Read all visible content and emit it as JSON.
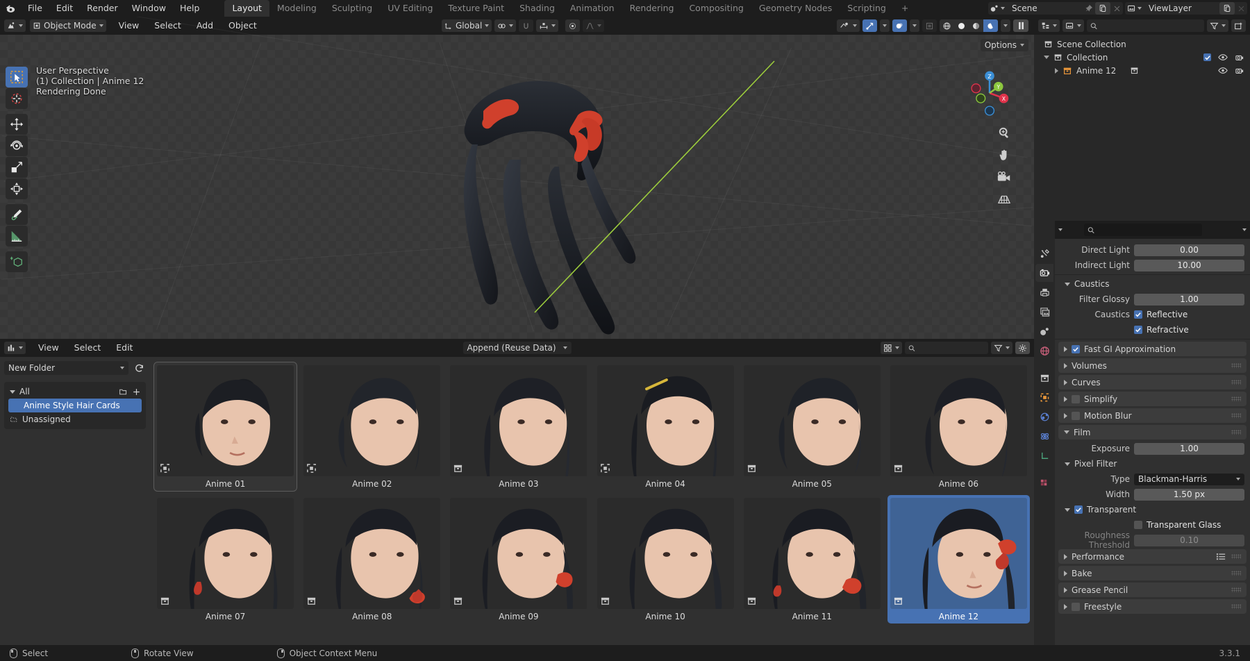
{
  "app": {
    "name": "Blender",
    "version": "3.3.1"
  },
  "topbar": {
    "menus": [
      "File",
      "Edit",
      "Render",
      "Window",
      "Help"
    ],
    "workspaces": [
      {
        "label": "Layout",
        "active": true
      },
      {
        "label": "Modeling",
        "active": false
      },
      {
        "label": "Sculpting",
        "active": false
      },
      {
        "label": "UV Editing",
        "active": false
      },
      {
        "label": "Texture Paint",
        "active": false
      },
      {
        "label": "Shading",
        "active": false
      },
      {
        "label": "Animation",
        "active": false
      },
      {
        "label": "Rendering",
        "active": false
      },
      {
        "label": "Compositing",
        "active": false
      },
      {
        "label": "Geometry Nodes",
        "active": false
      },
      {
        "label": "Scripting",
        "active": false
      },
      {
        "label": "+",
        "active": false
      }
    ],
    "scene_name": "Scene",
    "viewlayer_name": "ViewLayer"
  },
  "viewport": {
    "mode": "Object Mode",
    "menus": [
      "View",
      "Select",
      "Add",
      "Object"
    ],
    "transform_orientation": "Global",
    "options_label": "Options",
    "overlay": {
      "line1": "User Perspective",
      "line2": "(1) Collection | Anime 12",
      "line3": "Rendering Done"
    },
    "gizmo_axes": [
      "Z",
      "Y",
      "X"
    ]
  },
  "asset_browser": {
    "menus": [
      "View",
      "Select",
      "Edit"
    ],
    "import_method": "Append (Reuse Data)",
    "folder": "New Folder",
    "search_placeholder": "",
    "catalogs": [
      {
        "label": "All",
        "type": "root",
        "selected": false
      },
      {
        "label": "Anime Style Hair Cards",
        "type": "catalog",
        "selected": true
      },
      {
        "label": "Unassigned",
        "type": "unassigned",
        "selected": false
      }
    ],
    "assets": [
      {
        "label": "Anime 01",
        "icon": "object-icon",
        "state": "active",
        "hair": "bun"
      },
      {
        "label": "Anime 02",
        "icon": "object-icon",
        "state": "normal",
        "hair": "bob"
      },
      {
        "label": "Anime 03",
        "icon": "collection-icon",
        "state": "normal",
        "hair": "long"
      },
      {
        "label": "Anime 04",
        "icon": "object-icon",
        "state": "normal",
        "hair": "pin"
      },
      {
        "label": "Anime 05",
        "icon": "collection-icon",
        "state": "normal",
        "hair": "short"
      },
      {
        "label": "Anime 06",
        "icon": "collection-icon",
        "state": "normal",
        "hair": "medium"
      },
      {
        "label": "Anime 07",
        "icon": "collection-icon",
        "state": "normal",
        "hair": "ponytail"
      },
      {
        "label": "Anime 08",
        "icon": "collection-icon",
        "state": "normal",
        "hair": "bow"
      },
      {
        "label": "Anime 09",
        "icon": "collection-icon",
        "state": "normal",
        "hair": "tail-red"
      },
      {
        "label": "Anime 10",
        "icon": "collection-icon",
        "state": "normal",
        "hair": "tail"
      },
      {
        "label": "Anime 11",
        "icon": "collection-icon",
        "state": "normal",
        "hair": "braid"
      },
      {
        "label": "Anime 12",
        "icon": "collection-icon",
        "state": "selected",
        "hair": "twin"
      }
    ]
  },
  "outliner": {
    "search_placeholder": "",
    "rows": [
      {
        "label": "Scene Collection",
        "depth": 0,
        "icon": "scene-collection-icon",
        "expander": "none",
        "has_toggles": false,
        "checked": false
      },
      {
        "label": "Collection",
        "depth": 1,
        "icon": "collection-icon",
        "expander": "down",
        "has_toggles": true,
        "checked": true
      },
      {
        "label": "Anime 12",
        "depth": 2,
        "icon": "collection-orange-icon",
        "expander": "right",
        "has_toggles": true,
        "checked": false
      }
    ]
  },
  "properties": {
    "tabs": [
      "tool-icon",
      "render-icon",
      "output-icon",
      "viewlayer-icon",
      "scene-icon",
      "world-icon",
      "collection-icon",
      "object-icon",
      "modifier-icon",
      "physics-icon",
      "constraint-icon",
      "data-icon",
      "material-icon"
    ],
    "active_tab_index": 1,
    "search_placeholder": "",
    "fields": [
      {
        "kind": "value",
        "label": "Direct Light",
        "value": "0.00"
      },
      {
        "kind": "value",
        "label": "Indirect Light",
        "value": "10.00"
      }
    ],
    "caustics_panel": {
      "title": "Caustics",
      "open": true,
      "filter_glossy_label": "Filter Glossy",
      "filter_glossy_value": "1.00",
      "caustics_label": "Caustics",
      "reflective_label": "Reflective",
      "reflective_checked": true,
      "refractive_label": "Refractive",
      "refractive_checked": true
    },
    "fast_gi": {
      "label": "Fast GI Approximation",
      "checked": true
    },
    "panels": [
      {
        "label": "Volumes",
        "checkbox": null,
        "open": false
      },
      {
        "label": "Curves",
        "checkbox": null,
        "open": false
      },
      {
        "label": "Simplify",
        "checkbox": false,
        "open": false
      },
      {
        "label": "Motion Blur",
        "checkbox": false,
        "open": false
      }
    ],
    "film_panel": {
      "title": "Film",
      "exposure_label": "Exposure",
      "exposure_value": "1.00",
      "pixel_filter_title": "Pixel Filter",
      "type_label": "Type",
      "type_value": "Blackman-Harris",
      "width_label": "Width",
      "width_value": "1.50 px",
      "transparent_label": "Transparent",
      "transparent_checked": true,
      "transparent_glass_label": "Transparent Glass",
      "transparent_glass_checked": false,
      "roughness_label": "Roughness Threshold",
      "roughness_value": "0.10"
    },
    "bottom_panels": [
      {
        "label": "Performance",
        "checkbox": null,
        "open": false,
        "has_preset": true
      },
      {
        "label": "Bake",
        "checkbox": null,
        "open": false,
        "has_preset": false
      },
      {
        "label": "Grease Pencil",
        "checkbox": null,
        "open": false,
        "has_preset": false
      },
      {
        "label": "Freestyle",
        "checkbox": false,
        "open": false,
        "has_preset": false
      }
    ]
  },
  "statusbar": {
    "items": [
      {
        "mouse": "left",
        "label": "Select"
      },
      {
        "mouse": "middle",
        "label": "Rotate View"
      },
      {
        "mouse": "right",
        "label": "Object Context Menu"
      }
    ],
    "version": "3.3.1"
  },
  "colors": {
    "accent_blue": "#4772b3",
    "bg_dark": "#1d1d1d",
    "bg_panel": "#303030",
    "bg_outliner": "#282828",
    "orange": "#e8963a"
  }
}
